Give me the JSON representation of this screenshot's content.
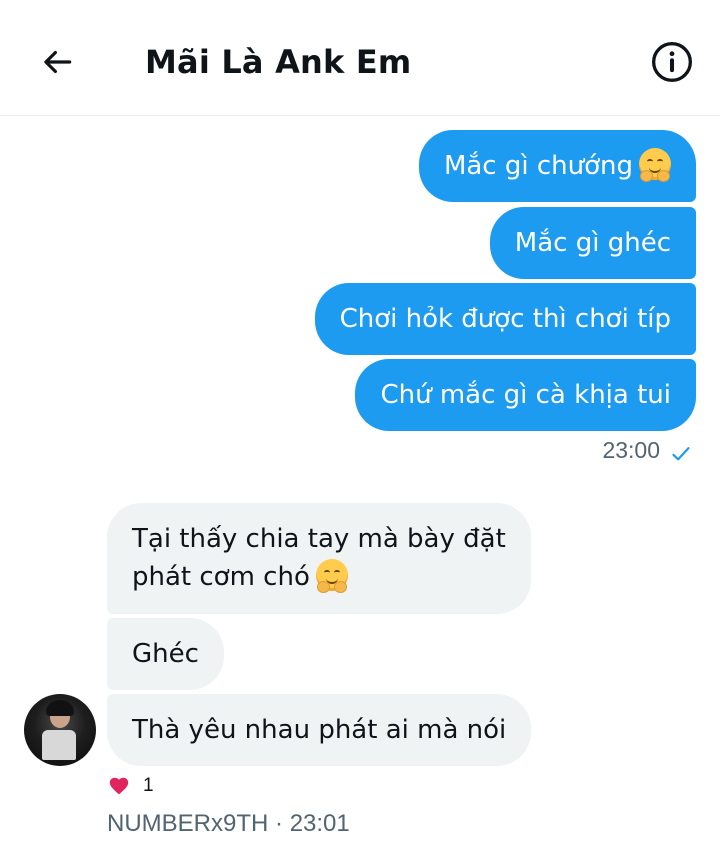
{
  "header": {
    "title": "Mãi Là Ank Em",
    "back_icon": "arrow-left-icon",
    "info_icon": "info-circle-icon"
  },
  "outgoing": {
    "messages": [
      "Mắc gì chướng",
      "Mắc gì ghéc",
      "Chơi hỏk được thì chơi típ",
      "Chứ mắc gì cà khịa tui"
    ],
    "time": "23:00",
    "status_icon": "checkmark-icon"
  },
  "incoming": {
    "messages": [
      "Tại thấy chia tay mà bày đặt",
      "phát cơm chó",
      "Ghéc",
      "Thà yêu nhau phát ai mà nói"
    ],
    "reaction_count": "1",
    "reaction_icon": "heart-icon",
    "sender": "NUMBERx9TH",
    "separator": "·",
    "time": "23:01"
  },
  "colors": {
    "outgoing_bubble": "#1d9bf0",
    "incoming_bubble": "#eff3f4",
    "heart": "#f91880",
    "meta_text": "#536471"
  }
}
